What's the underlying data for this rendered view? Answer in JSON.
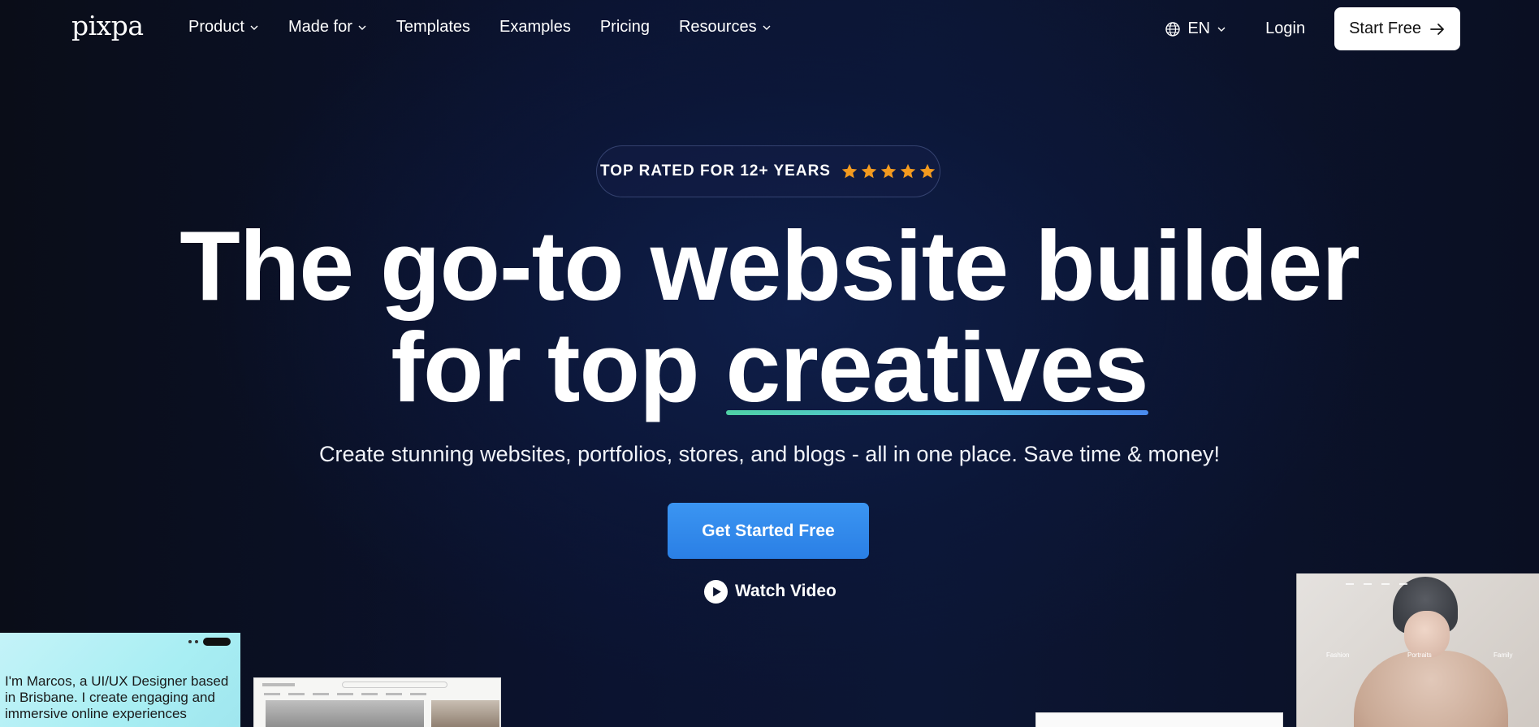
{
  "nav": {
    "logo": "pixpa",
    "menu": [
      {
        "label": "Product",
        "has_dropdown": true
      },
      {
        "label": "Made for",
        "has_dropdown": true
      },
      {
        "label": "Templates",
        "has_dropdown": false
      },
      {
        "label": "Examples",
        "has_dropdown": false
      },
      {
        "label": "Pricing",
        "has_dropdown": false
      },
      {
        "label": "Resources",
        "has_dropdown": true
      }
    ],
    "language": "EN",
    "login": "Login",
    "start_free": "Start Free"
  },
  "hero": {
    "badge": "TOP RATED FOR 12+ YEARS",
    "rating_stars": 5,
    "headline_line1": "The go-to website builder",
    "headline_line2_prefix": "for top",
    "headline_highlight": "creatives",
    "subtitle": "Create stunning websites, portfolios, stores, and blogs - all in one place. Save time & money!",
    "cta": "Get Started Free",
    "watch_video": "Watch Video"
  },
  "previews": {
    "card1_intro": "I'm Marcos, a UI/UX Designer based in Brisbane. I create engaging and immersive online experiences",
    "card4_categories": [
      "Fashion",
      "Portraits",
      "Family"
    ]
  },
  "colors": {
    "cta_blue": "#2a7fe5",
    "star_orange": "#f39a1f",
    "underline_start": "#4fd1a5",
    "underline_end": "#4a8bf0"
  }
}
